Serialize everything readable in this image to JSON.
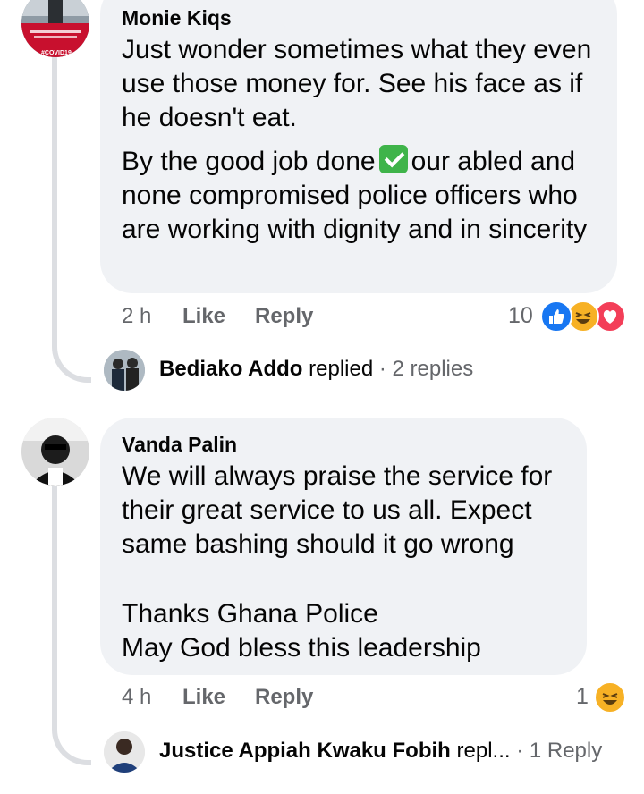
{
  "comments": [
    {
      "author": "Monie Kiqs",
      "lines": [
        "Just wonder sometimes what they even use those money for. See his face as if he doesn't eat."
      ],
      "para2_before": "By the good job done",
      "para2_after": "our abled and none compromised police officers who are working with dignity and in sincerity",
      "avatar_text": "#COVID19",
      "time": "2 h",
      "like": "Like",
      "reply": "Reply",
      "reaction_count": "10",
      "reactions": [
        "like-icon",
        "haha-icon",
        "love-icon"
      ],
      "replied_name": "Bediako Addo",
      "replied_word": "replied",
      "replied_count": "· 2 replies"
    },
    {
      "author": "Vanda Palin",
      "text1": "We will always praise the service for their great service to us all. Expect same bashing should it go wrong",
      "text2a": "Thanks Ghana Police",
      "text2b": "May God bless this leadership",
      "time": "4 h",
      "like": "Like",
      "reply": "Reply",
      "reaction_count": "1",
      "reactions": [
        "haha-icon"
      ],
      "replied_name": "Justice Appiah Kwaku Fobih",
      "replied_word": "repl...",
      "replied_count": "· 1 Reply"
    }
  ],
  "colors": {
    "bubble": "#f0f2f5",
    "meta": "#65676b",
    "like_blue": "#1877f2",
    "love_red": "#f33e58",
    "haha_yellow": "#f7b125",
    "check_green": "#3fb44a"
  }
}
